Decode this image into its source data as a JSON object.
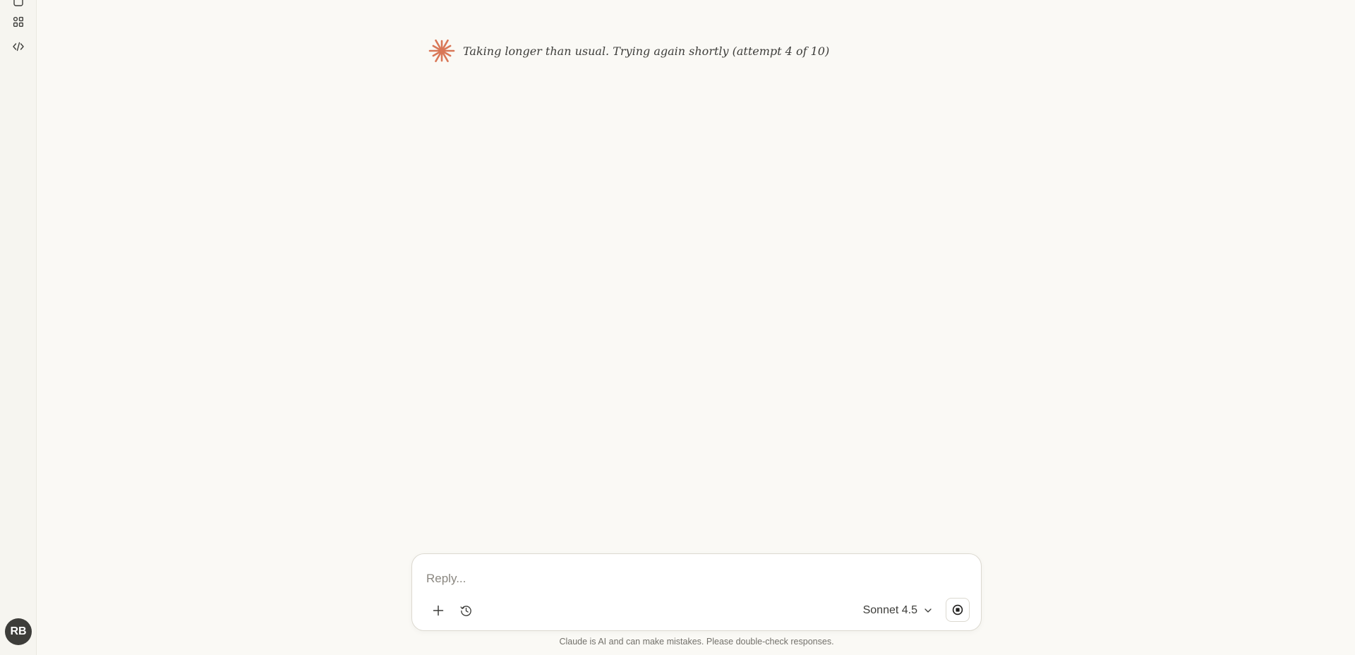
{
  "sidebar": {
    "icons": [
      "chat-icon",
      "artifacts-icon",
      "code-icon"
    ],
    "avatar_initials": "RB"
  },
  "status": {
    "icon": "claude-spark-icon",
    "message": "Taking longer than usual. Trying again shortly (attempt 4 of 10)",
    "accent_color": "#d97757"
  },
  "composer": {
    "placeholder": "Reply...",
    "value": "",
    "add_icon": "plus-icon",
    "history_icon": "clock-icon",
    "model_label": "Sonnet 4.5",
    "stop_icon": "stop-icon"
  },
  "footer": {
    "disclaimer": "Claude is AI and can make mistakes. Please double-check responses."
  }
}
